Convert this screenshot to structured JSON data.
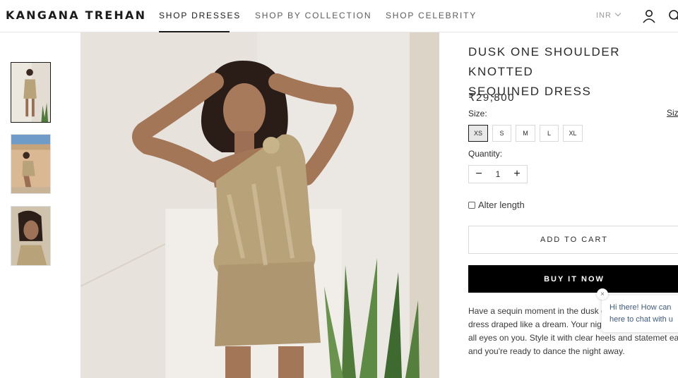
{
  "header": {
    "logo": "KANGANA TREHAN",
    "nav": [
      "SHOP DRESSES",
      "SHOP BY COLLECTION",
      "SHOP CELEBRITY"
    ],
    "active_nav": "SHOP DRESSES",
    "currency": "INR",
    "icons": [
      "chevron-down-icon",
      "user-icon",
      "search-icon"
    ]
  },
  "gallery": {
    "thumbnails": [
      "thumbnail-1",
      "thumbnail-2",
      "thumbnail-3"
    ],
    "selected_index": 0
  },
  "product": {
    "title_lines": [
      "DUSK ONE SHOULDER KNOTTED",
      "SEQUINED DRESS"
    ],
    "price": "₹29,800",
    "size_label": "Size:",
    "size_chart_link": "Siz",
    "sizes": [
      "XS",
      "S",
      "M",
      "L",
      "XL"
    ],
    "selected_size": "XS",
    "quantity_label": "Quantity:",
    "quantity_minus": "−",
    "quantity_value": "1",
    "quantity_plus": "+",
    "alter_length_label": "Alter length",
    "add_to_cart": "ADD TO CART",
    "buy_it_now": "BUY IT NOW",
    "description_lines": [
      "Have a sequin moment in the dusk on",
      "dress draped like a dream. Your nigh",
      "all eyes on you. Style it with clear heels and statemet earrin",
      "and you're ready to dance the night away."
    ]
  },
  "chat": {
    "close": "×",
    "lines": [
      "Hi there! How can",
      "here to chat with u"
    ]
  },
  "colors": {
    "text": "#1c1b1b",
    "border": "#d9d9d9",
    "buy_button": "#000000",
    "chat_text": "#3d5a80",
    "dress_gold": "#b8a27a"
  }
}
